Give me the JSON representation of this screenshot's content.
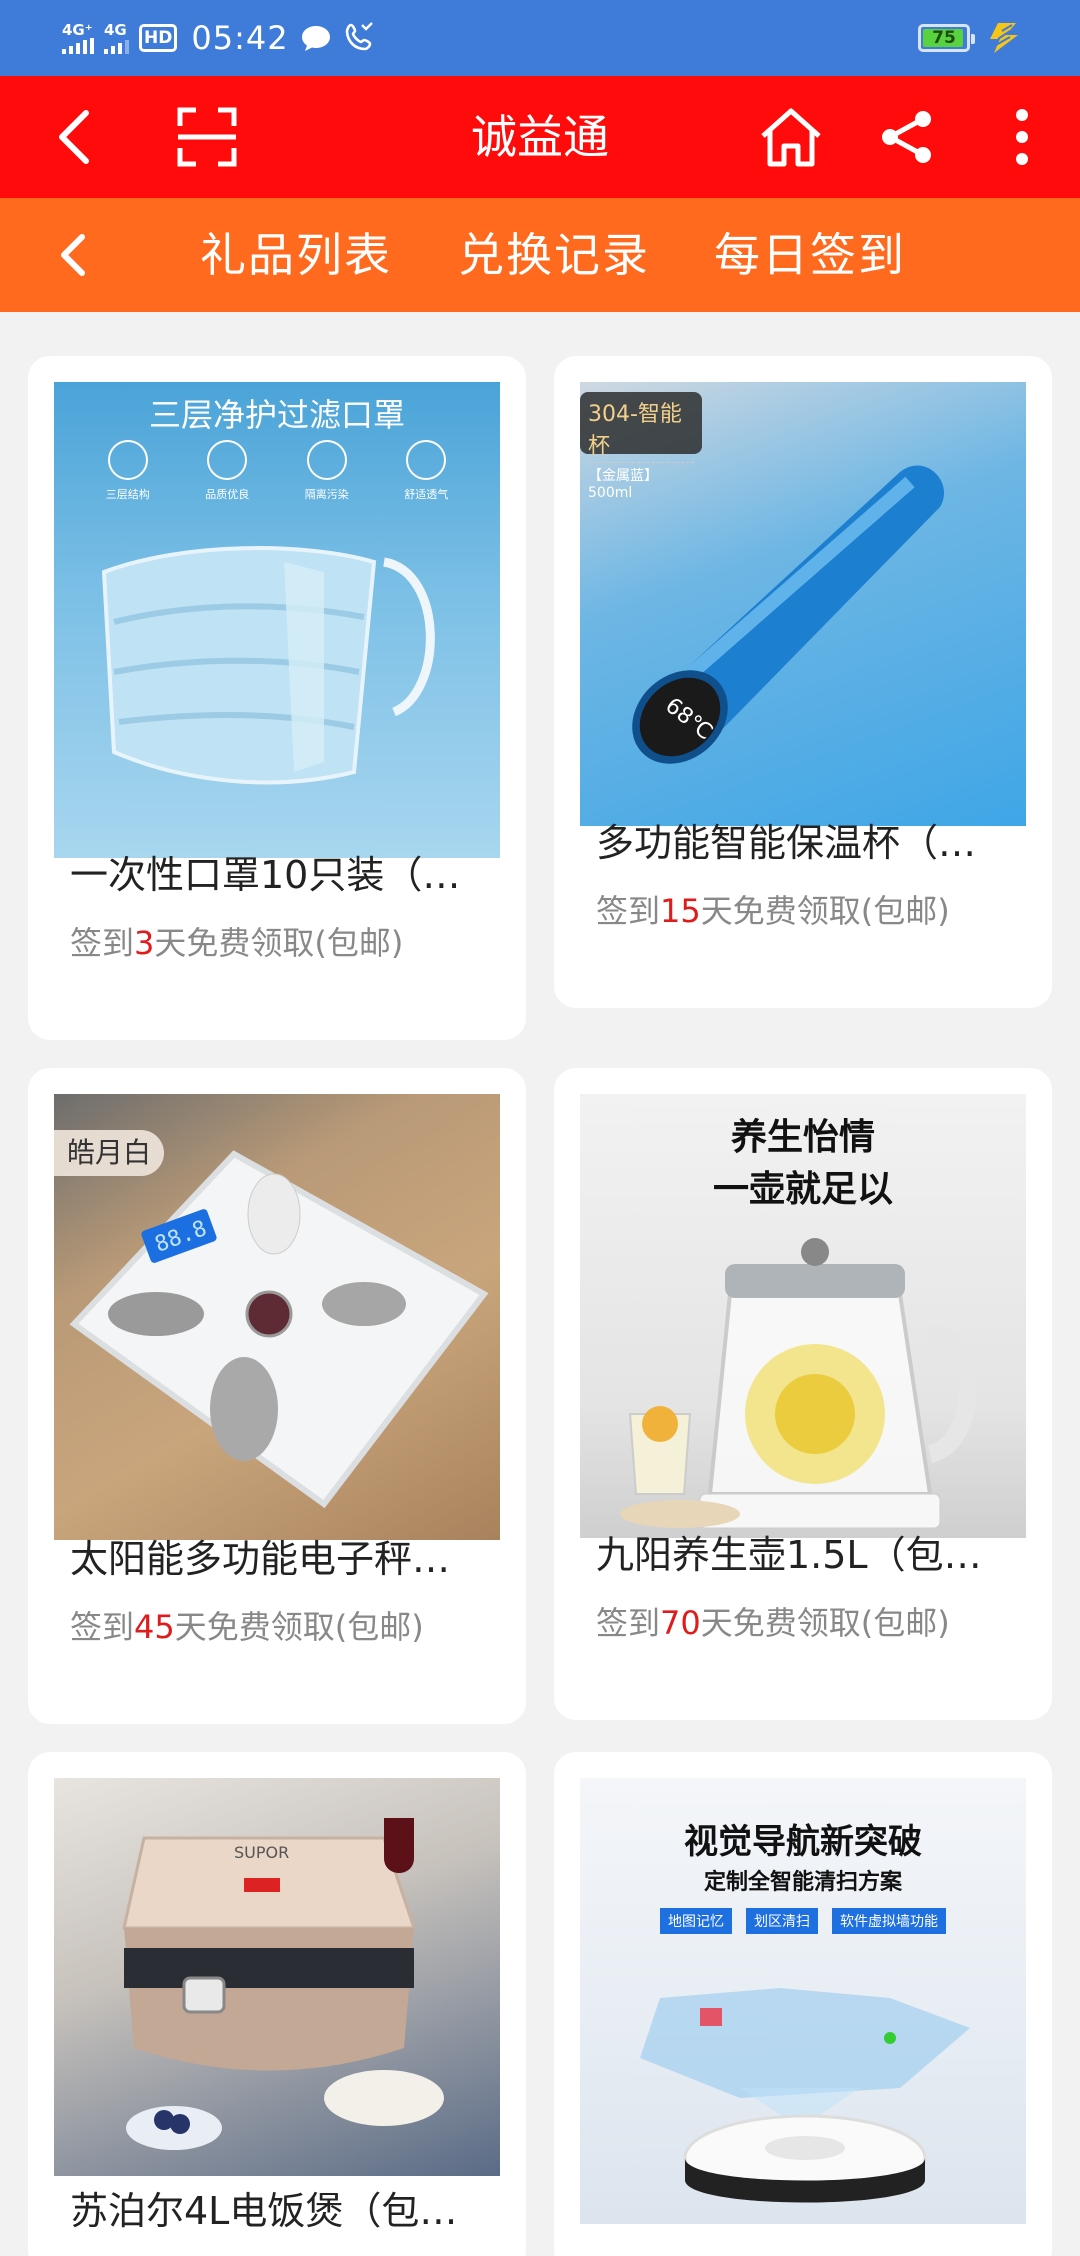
{
  "status_bar": {
    "sim1": "4G⁺",
    "sim2": "4G",
    "hd": "HD",
    "time": "05:42",
    "battery": "75",
    "battery_level_percent": 75,
    "icons": [
      "signal-icon",
      "hd-voice-icon",
      "chat-bubble-icon",
      "missed-call-icon",
      "battery-icon",
      "charging-bolt-icon"
    ]
  },
  "title_bar": {
    "title": "诚益通",
    "icons": [
      "back-arrow-icon",
      "scan-icon",
      "home-icon",
      "share-icon",
      "more-vertical-icon"
    ]
  },
  "sub_nav": {
    "tabs": [
      "礼品列表",
      "兑换记录",
      "每日签到"
    ]
  },
  "colors": {
    "status_bar": "#3f7bd9",
    "title_bar": "#ff0b0b",
    "sub_nav": "#ff6a1f",
    "highlight_number": "#e01b1b"
  },
  "products": [
    {
      "name": "一次性口罩10只装（…",
      "desc_prefix": "签到",
      "days": "3",
      "desc_suffix": "天免费领取(包邮)",
      "image_texts": [
        "三层净护过滤口罩",
        "三层结构",
        "品质优良",
        "隔离污染",
        "舒适透气"
      ]
    },
    {
      "name": "多功能智能保温杯（…",
      "desc_prefix": "签到",
      "days": "15",
      "desc_suffix": "天免费领取(包邮)",
      "image_texts": [
        "304-智能杯",
        "【金属蓝】500ml",
        "68℃"
      ]
    },
    {
      "name": "太阳能多功能电子秤…",
      "desc_prefix": "签到",
      "days": "45",
      "desc_suffix": "天免费领取(包邮)",
      "image_texts": [
        "皓月白",
        "88.8"
      ]
    },
    {
      "name": "九阳养生壶1.5L（包…",
      "desc_prefix": "签到",
      "days": "70",
      "desc_suffix": "天免费领取(包邮)",
      "image_texts": [
        "养生怡情",
        "一壶就足以"
      ]
    },
    {
      "name": "苏泊尔4L电饭煲（包…",
      "image_texts": [
        "SUPOR"
      ]
    },
    {
      "image_texts": [
        "视觉导航新突破",
        "定制全智能清扫方案",
        "地图记忆",
        "划区清扫",
        "软件虚拟墙功能"
      ]
    }
  ]
}
